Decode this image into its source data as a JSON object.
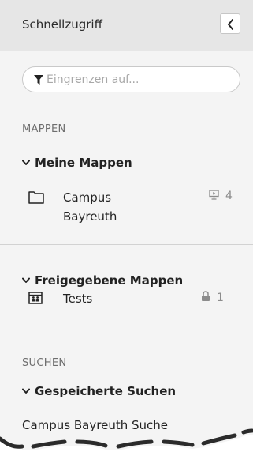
{
  "header": {
    "title": "Schnellzugriff"
  },
  "filter": {
    "placeholder": "Eingrenzen auf..."
  },
  "sections": {
    "mappen_label": "MAPPEN",
    "suchen_label": "SUCHEN"
  },
  "meine_mappen": {
    "label": "Meine Mappen",
    "items": [
      {
        "name": "Campus Bayreuth",
        "icon": "presentation-icon",
        "count": "4"
      }
    ]
  },
  "freigegebene_mappen": {
    "label": "Freigegebene Mappen",
    "items": [
      {
        "name": "Tests",
        "icon": "lock-icon",
        "count": "1"
      }
    ]
  },
  "gespeicherte_suchen": {
    "label": "Gespeicherte Suchen",
    "items": [
      {
        "name": "Campus Bayreuth Suche"
      }
    ]
  },
  "colors": {
    "panel_bg": "#f4f4f4",
    "header_bg": "#e6e6e6",
    "muted_text": "#6e6e6e",
    "badge_text": "#8c8c8c",
    "torn_edge": "#2b2b2b"
  }
}
